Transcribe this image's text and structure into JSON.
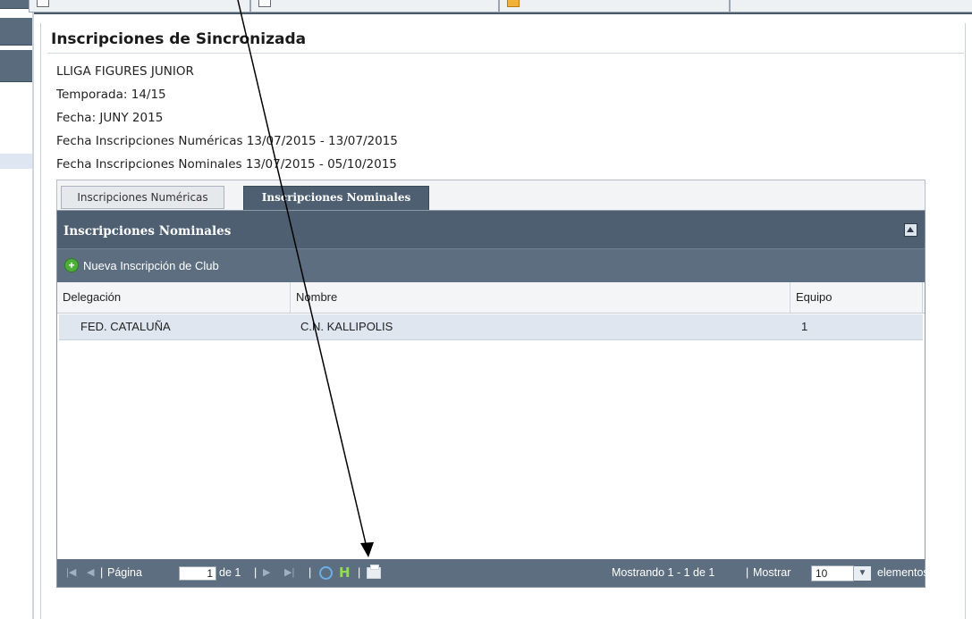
{
  "page": {
    "title": "Inscripciones de Sincronizada",
    "info": [
      "LLIGA FIGURES JUNIOR",
      "Temporada: 14/15",
      "Fecha: JUNY 2015",
      "Fecha Inscripciones Numéricas 13/07/2015 - 13/07/2015",
      "Fecha Inscripciones Nominales 13/07/2015 - 05/10/2015"
    ]
  },
  "tabs": [
    {
      "label": "Inscripciones Numéricas",
      "active": false
    },
    {
      "label": "Inscripciones Nominales",
      "active": true
    }
  ],
  "panel": {
    "title": "Inscripciones Nominales",
    "new_button": "Nueva Inscripción de Club",
    "columns": [
      "Delegación",
      "Nombre",
      "Equipo"
    ],
    "rows": [
      {
        "delegacion": "FED. CATALUÑA",
        "nombre": "C.N. KALLIPOLIS",
        "equipo": "1"
      }
    ]
  },
  "pager": {
    "page_label": "Página",
    "page_value": "1",
    "of_label": "de 1",
    "display": "Mostrando 1 - 1 de 1",
    "show_label": "Mostrar",
    "page_size": "10",
    "items_label": "elementos"
  },
  "icons": {
    "first": "first-page-icon",
    "prev": "prev-page-icon",
    "next": "next-page-icon",
    "last": "last-page-icon",
    "refresh": "refresh-icon",
    "export": "excel-export-icon",
    "print": "print-icon",
    "new": "add-circle-icon",
    "collapse": "collapse-icon"
  },
  "colors": {
    "header": "#4e5f71",
    "toolbar": "#5d6e80",
    "row_selected": "#dfe6f0",
    "annotation": "#000000"
  }
}
